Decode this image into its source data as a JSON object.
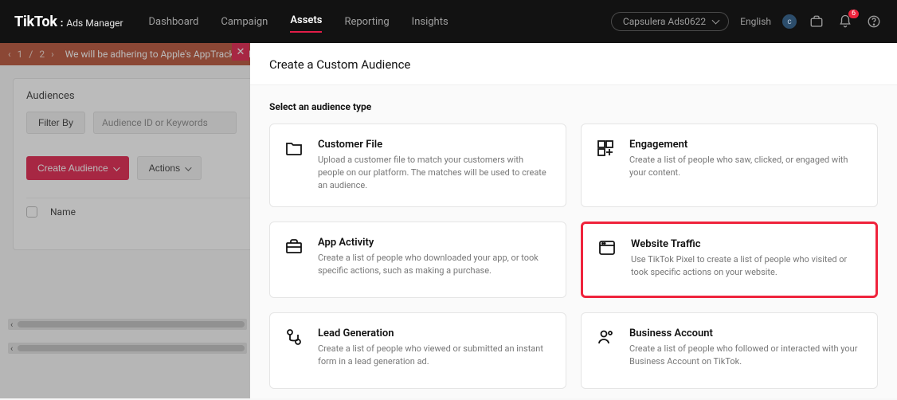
{
  "brand": {
    "tiktok": "TikTok",
    "manager": "Ads Manager"
  },
  "nav": {
    "dashboard": "Dashboard",
    "campaign": "Campaign",
    "assets": "Assets",
    "reporting": "Reporting",
    "insights": "Insights",
    "account": "Capsulera Ads0622",
    "language": "English",
    "avatar_initial": "c",
    "notif_count": "6"
  },
  "notice": {
    "pager_index": "1",
    "pager_sep": "/",
    "pager_total": "2",
    "text": "We will be adhering to Apple's AppTrackingTrans",
    "close": "✕"
  },
  "left": {
    "heading": "Audiences",
    "filter_by": "Filter By",
    "search_placeholder": "Audience ID or Keywords",
    "create_audience": "Create Audience",
    "actions": "Actions",
    "col_name": "Name"
  },
  "modal": {
    "title": "Create a Custom Audience",
    "section": "Select an audience type",
    "cards": {
      "customer_file": {
        "title": "Customer File",
        "desc": "Upload a customer file to match your customers with people on our platform. The matches will be used to create an audience."
      },
      "engagement": {
        "title": "Engagement",
        "desc": "Create a list of people who saw, clicked, or engaged with your content."
      },
      "app_activity": {
        "title": "App Activity",
        "desc": "Create a list of people who downloaded your app, or took specific actions, such as making a purchase."
      },
      "website_traffic": {
        "title": "Website Traffic",
        "desc": "Use TikTok Pixel to create a list of people who visited or took specific actions on your website."
      },
      "lead_generation": {
        "title": "Lead Generation",
        "desc": "Create a list of people who viewed or submitted an instant form in a lead generation ad."
      },
      "business_account": {
        "title": "Business Account",
        "desc": "Create a list of people who followed or interacted with your Business Account on TikTok."
      }
    }
  }
}
